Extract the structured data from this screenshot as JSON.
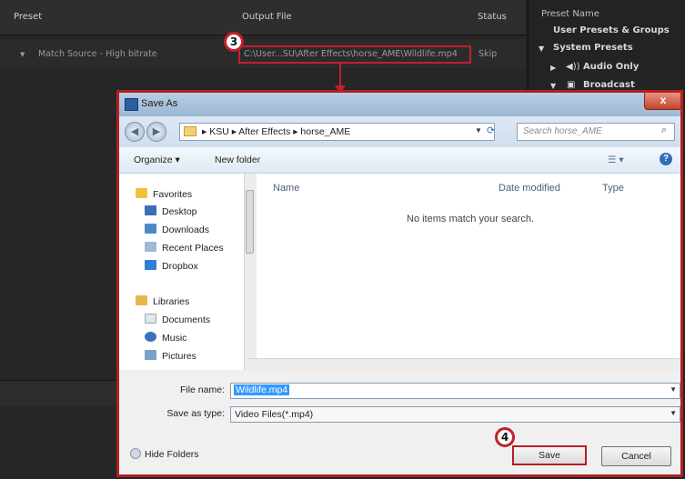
{
  "ame": {
    "header": {
      "preset": "Preset",
      "output_file": "Output File",
      "status": "Status"
    },
    "queue_row": {
      "preset": "Match Source - High bitrate",
      "output": "C:\\User...SU\\After Effects\\horse_AME\\Wildlife.mp4",
      "status": "Skip"
    },
    "presets": {
      "title": "Preset Name",
      "user_presets": "User Presets & Groups",
      "system_presets": "System Presets",
      "audio_only": "Audio Only",
      "broadcast": "Broadcast"
    },
    "step3": "3",
    "step4": "4"
  },
  "dialog": {
    "title": "Save As",
    "close_glyph": "x",
    "breadcrumbs": "▸  KSU  ▸  After Effects  ▸  horse_AME",
    "search_placeholder": "Search horse_AME",
    "toolbar": {
      "organize": "Organize ▾",
      "new_folder": "New folder"
    },
    "nav": {
      "favorites": "Favorites",
      "desktop": "Desktop",
      "downloads": "Downloads",
      "recent_places": "Recent Places",
      "dropbox": "Dropbox",
      "libraries": "Libraries",
      "documents": "Documents",
      "music": "Music",
      "pictures": "Pictures"
    },
    "columns": {
      "name": "Name",
      "date_modified": "Date modified",
      "type": "Type"
    },
    "empty_message": "No items match your search.",
    "file_name_label": "File name:",
    "file_name_value": "Wildlife.mp4",
    "save_type_label": "Save as type:",
    "save_type_value": "Video Files(*.mp4)",
    "hide_folders": "Hide Folders",
    "save": "Save",
    "cancel": "Cancel"
  },
  "colors": {
    "annotation": "#c0212c",
    "selection": "#3399ff",
    "dialog_title_bar": "#9bb7d4"
  }
}
